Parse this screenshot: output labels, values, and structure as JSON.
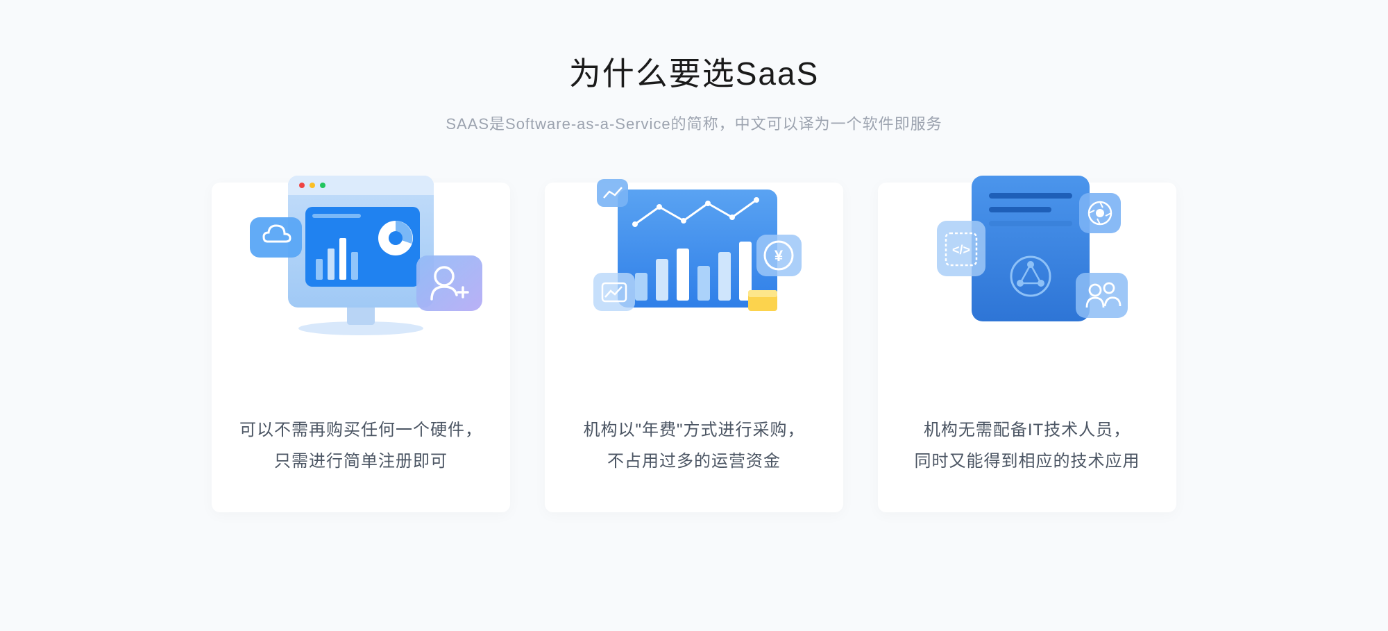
{
  "header": {
    "title": "为什么要选SaaS",
    "subtitle": "SAAS是Software-as-a-Service的简称，中文可以译为一个软件即服务"
  },
  "cards": [
    {
      "line1": "可以不需再购买任何一个硬件，",
      "line2": "只需进行简单注册即可"
    },
    {
      "line1": "机构以\"年费\"方式进行采购，",
      "line2": "不占用过多的运营资金"
    },
    {
      "line1": "机构无需配备IT技术人员，",
      "line2": "同时又能得到相应的技术应用"
    }
  ]
}
